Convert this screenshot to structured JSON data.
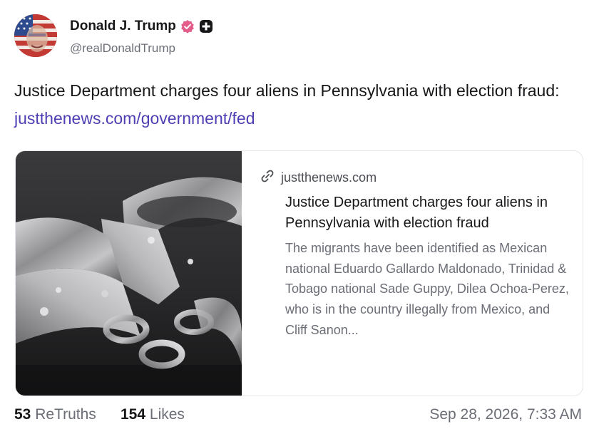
{
  "author": {
    "display_name": "Donald J. Trump",
    "handle": "@realDonaldTrump",
    "verified_icon": "verified-badge-icon",
    "extra_badge_icon": "plus-badge-icon",
    "verified_color": "#e35d8a"
  },
  "post": {
    "text": "Justice Department charges four aliens in Pennsylvania with election fraud: ",
    "link_text": "justthenews.com/government/fed",
    "link_color": "#4d3fb3"
  },
  "card": {
    "image_icon": "handcuffs-image",
    "domain_icon": "link-icon",
    "domain": "justthenews.com",
    "title": "Justice Department charges four aliens in Pennsylvania with election fraud",
    "description": "The migrants have been identified as Mexican national Eduardo Gallardo Maldonado, Trinidad & Tobago national Sade Guppy, Dilea Ochoa-Perez, who is in the country illegally from Mexico, and Cliff Sanon..."
  },
  "footer": {
    "retruths_count": "53",
    "retruths_label": "ReTruths",
    "likes_count": "154",
    "likes_label": "Likes",
    "timestamp": "Sep 28, 2026, 7:33 AM"
  }
}
